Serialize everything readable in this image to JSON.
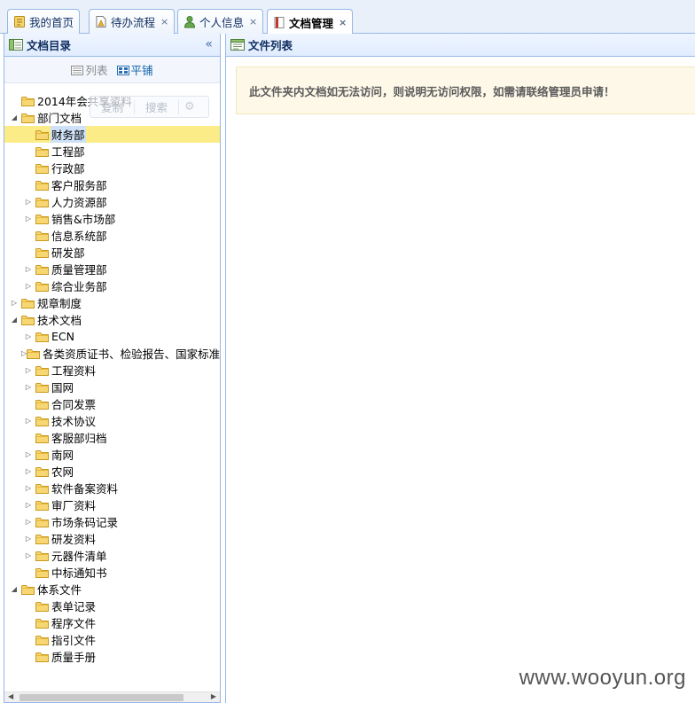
{
  "tabs": [
    {
      "label": "我的首页",
      "icon": "home-note-icon",
      "closable": false,
      "active": false
    },
    {
      "label": "待办流程",
      "icon": "todo-doc-icon",
      "closable": true,
      "active": false
    },
    {
      "label": "个人信息",
      "icon": "user-icon",
      "closable": true,
      "active": false
    },
    {
      "label": "文档管理",
      "icon": "book-icon",
      "closable": true,
      "active": true
    }
  ],
  "close_glyph": "×",
  "left_panel": {
    "title": "文档目录",
    "collapse_glyph": "«",
    "view_list_label": "列表",
    "view_tile_label": "平铺",
    "search_overlay": {
      "left_text": "复制",
      "search_text": "搜索",
      "gear_glyph": "⚙"
    }
  },
  "tree": [
    {
      "label": "2014年会共享资料",
      "level": 0,
      "toggle": "none"
    },
    {
      "label": "部门文档",
      "level": 0,
      "toggle": "open"
    },
    {
      "label": "财务部",
      "level": 1,
      "toggle": "none",
      "selected": true
    },
    {
      "label": "工程部",
      "level": 1,
      "toggle": "none"
    },
    {
      "label": "行政部",
      "level": 1,
      "toggle": "none"
    },
    {
      "label": "客户服务部",
      "level": 1,
      "toggle": "none"
    },
    {
      "label": "人力资源部",
      "level": 1,
      "toggle": "closed"
    },
    {
      "label": "销售&市场部",
      "level": 1,
      "toggle": "closed"
    },
    {
      "label": "信息系统部",
      "level": 1,
      "toggle": "none"
    },
    {
      "label": "研发部",
      "level": 1,
      "toggle": "none"
    },
    {
      "label": "质量管理部",
      "level": 1,
      "toggle": "closed"
    },
    {
      "label": "综合业务部",
      "level": 1,
      "toggle": "closed"
    },
    {
      "label": "规章制度",
      "level": 0,
      "toggle": "closed"
    },
    {
      "label": "技术文档",
      "level": 0,
      "toggle": "open"
    },
    {
      "label": "ECN",
      "level": 1,
      "toggle": "closed"
    },
    {
      "label": "各类资质证书、检验报告、国家标准",
      "level": 1,
      "toggle": "closed"
    },
    {
      "label": "工程资料",
      "level": 1,
      "toggle": "closed"
    },
    {
      "label": "国网",
      "level": 1,
      "toggle": "closed"
    },
    {
      "label": "合同发票",
      "level": 1,
      "toggle": "none"
    },
    {
      "label": "技术协议",
      "level": 1,
      "toggle": "closed"
    },
    {
      "label": "客服部归档",
      "level": 1,
      "toggle": "none"
    },
    {
      "label": "南网",
      "level": 1,
      "toggle": "closed"
    },
    {
      "label": "农网",
      "level": 1,
      "toggle": "closed"
    },
    {
      "label": "软件备案资料",
      "level": 1,
      "toggle": "closed"
    },
    {
      "label": "审厂资料",
      "level": 1,
      "toggle": "closed"
    },
    {
      "label": "市场条码记录",
      "level": 1,
      "toggle": "closed"
    },
    {
      "label": "研发资料",
      "level": 1,
      "toggle": "closed"
    },
    {
      "label": "元器件清单",
      "level": 1,
      "toggle": "closed"
    },
    {
      "label": "中标通知书",
      "level": 1,
      "toggle": "none"
    },
    {
      "label": "体系文件",
      "level": 0,
      "toggle": "open"
    },
    {
      "label": "表单记录",
      "level": 1,
      "toggle": "none"
    },
    {
      "label": "程序文件",
      "level": 1,
      "toggle": "none"
    },
    {
      "label": "指引文件",
      "level": 1,
      "toggle": "none"
    },
    {
      "label": "质量手册",
      "level": 1,
      "toggle": "none"
    }
  ],
  "right_panel": {
    "title": "文件列表",
    "notice": "此文件夹内文档如无法访问，则说明无访问权限，如需请联络管理员申请！"
  },
  "watermark": "www.wooyun.org",
  "colors": {
    "border": "#95b8e7",
    "header_bg": "#e0ecff",
    "selected_row": "#fbec88",
    "notice_bg": "#fdf8e8",
    "folder": "#f3c94d"
  }
}
